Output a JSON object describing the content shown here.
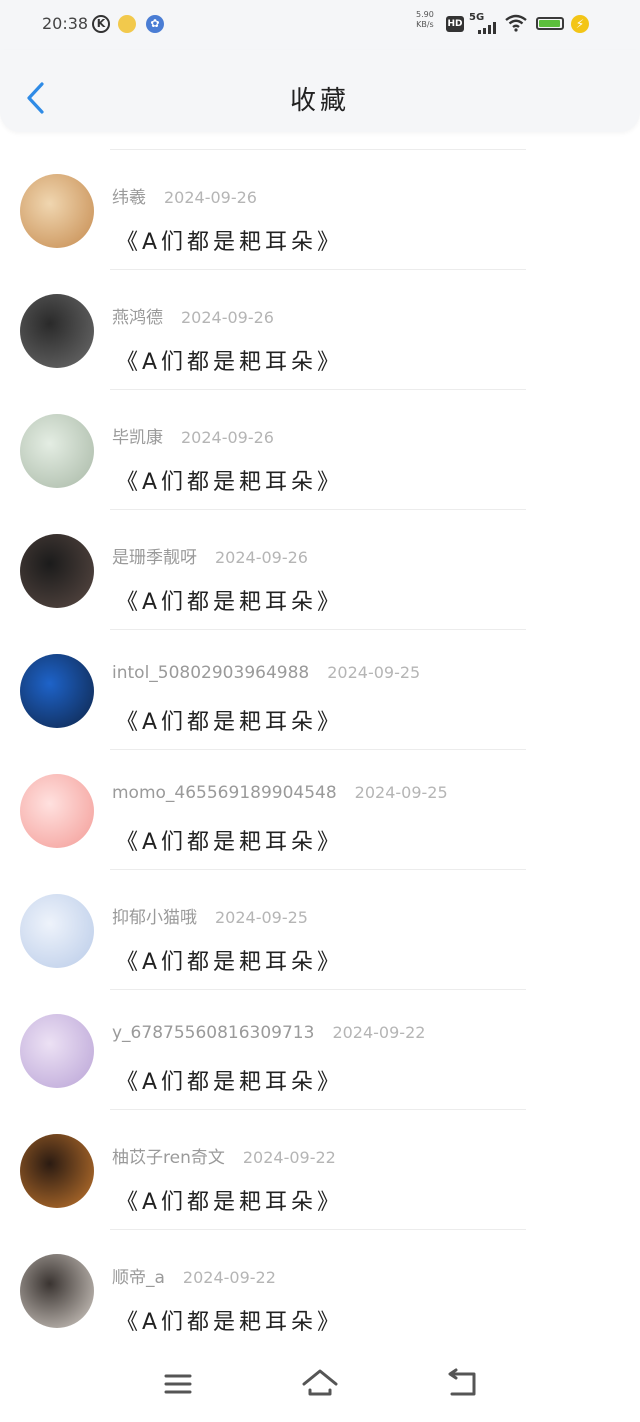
{
  "status_bar": {
    "time": "20:38",
    "net_speed_value": "5.90",
    "net_speed_unit": "KB/s",
    "hd_label": "HD",
    "network_label": "5G",
    "battery_level": 0.95,
    "battery_color": "#5cbf3c"
  },
  "header": {
    "back_icon": "chevron-left-icon",
    "title": "收藏",
    "accent": "#2f8be6"
  },
  "items": [
    {
      "name": "纬羲",
      "date": "2024-09-26",
      "quote": "《A们都是耙耳朵》",
      "avatar_colors": [
        "#f0d6b0",
        "#c58a4e"
      ]
    },
    {
      "name": "燕鸿德",
      "date": "2024-09-26",
      "quote": "《A们都是耙耳朵》",
      "avatar_colors": [
        "#2a2a2a",
        "#6d6d6d"
      ]
    },
    {
      "name": "毕凯康",
      "date": "2024-09-26",
      "quote": "《A们都是耙耳朵》",
      "avatar_colors": [
        "#e4ede3",
        "#a8b8a6"
      ]
    },
    {
      "name": "是珊季靓呀",
      "date": "2024-09-26",
      "quote": "《A们都是耙耳朵》",
      "avatar_colors": [
        "#1b1b1b",
        "#5a4a44"
      ]
    },
    {
      "name": "intol_50802903964988",
      "date": "2024-09-25",
      "quote": "《A们都是耙耳朵》",
      "avatar_colors": [
        "#1e63c9",
        "#0e2447"
      ]
    },
    {
      "name": "momo_465569189904548",
      "date": "2024-09-25",
      "quote": "《A们都是耙耳朵》",
      "avatar_colors": [
        "#ffe1df",
        "#f39b96"
      ]
    },
    {
      "name": "抑郁小猫哦",
      "date": "2024-09-25",
      "quote": "《A们都是耙耳朵》",
      "avatar_colors": [
        "#eef3fb",
        "#b9cbe8"
      ]
    },
    {
      "name": "y_67875560816309713",
      "date": "2024-09-22",
      "quote": "《A们都是耙耳朵》",
      "avatar_colors": [
        "#ece1f4",
        "#b9a3d6"
      ]
    },
    {
      "name": "柚苡子ren奇文",
      "date": "2024-09-22",
      "quote": "《A们都是耙耳朵》",
      "avatar_colors": [
        "#2b1b12",
        "#c4772e"
      ]
    },
    {
      "name": "顺帝_a",
      "date": "2024-09-22",
      "quote": "《A们都是耙耳朵》",
      "avatar_colors": [
        "#3a3431",
        "#d9d2cb"
      ]
    }
  ],
  "nav": {
    "menu_icon": "menu-icon",
    "home_icon": "home-icon",
    "back_icon": "back-arrow-icon"
  }
}
